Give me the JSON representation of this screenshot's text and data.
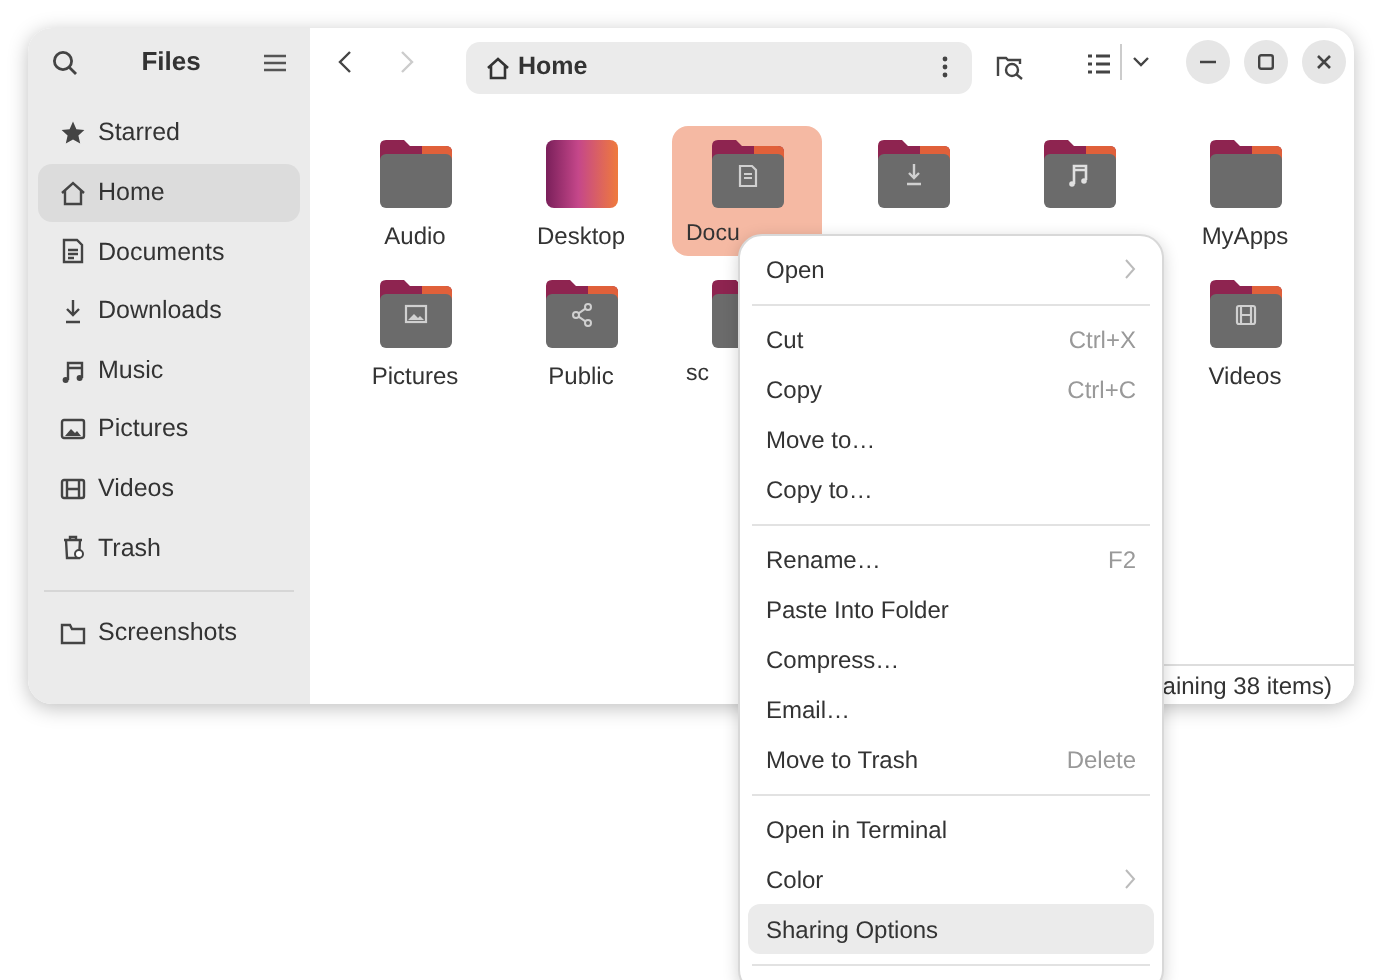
{
  "sidebar": {
    "title": "Files",
    "sections": [
      [
        {
          "label": "Starred",
          "kind": "star",
          "selected": false
        },
        {
          "label": "Home",
          "kind": "home",
          "selected": true
        },
        {
          "label": "Documents",
          "kind": "document",
          "selected": false
        },
        {
          "label": "Downloads",
          "kind": "download",
          "selected": false
        },
        {
          "label": "Music",
          "kind": "music",
          "selected": false
        },
        {
          "label": "Pictures",
          "kind": "picture",
          "selected": false
        },
        {
          "label": "Videos",
          "kind": "video",
          "selected": false
        },
        {
          "label": "Trash",
          "kind": "trash",
          "selected": false
        }
      ],
      [
        {
          "label": "Screenshots",
          "kind": "folder",
          "selected": false
        }
      ]
    ]
  },
  "toolbar": {
    "path": "Home"
  },
  "folders": [
    [
      {
        "label": "Audio",
        "kind": "plain",
        "selected": false
      },
      {
        "label": "Desktop",
        "kind": "desktop",
        "selected": false
      },
      {
        "label": "Docu",
        "kind": "document",
        "selected": true,
        "clipped": true
      },
      {
        "kind": "download",
        "selected": false
      },
      {
        "kind": "music",
        "selected": false
      },
      {
        "label": "MyApps",
        "kind": "plain",
        "selected": false
      }
    ],
    [
      {
        "label": "Pictures",
        "kind": "picture",
        "selected": false
      },
      {
        "label": "Public",
        "kind": "share",
        "selected": false
      },
      {
        "label": "sc",
        "kind": "plain",
        "selected": false,
        "clipped": true
      },
      {
        "label": "Videos",
        "kind": "video",
        "selected": false
      }
    ]
  ],
  "status_bar": "aining 38 items)",
  "context_menu": [
    [
      {
        "label": "Open",
        "submenu": true,
        "selected": false
      }
    ],
    [
      {
        "label": "Cut",
        "shortcut": "Ctrl+X",
        "selected": false
      },
      {
        "label": "Copy",
        "shortcut": "Ctrl+C",
        "selected": false
      },
      {
        "label": "Move to…",
        "selected": false
      },
      {
        "label": "Copy to…",
        "selected": false
      }
    ],
    [
      {
        "label": "Rename…",
        "shortcut": "F2",
        "selected": false
      },
      {
        "label": "Paste Into Folder",
        "selected": false
      },
      {
        "label": "Compress…",
        "selected": false
      },
      {
        "label": "Email…",
        "selected": false
      },
      {
        "label": "Move to Trash",
        "shortcut": "Delete",
        "selected": false
      }
    ],
    [
      {
        "label": "Open in Terminal",
        "selected": false
      },
      {
        "label": "Color",
        "submenu": true,
        "selected": false
      },
      {
        "label": "Sharing Options",
        "selected": true
      }
    ]
  ]
}
